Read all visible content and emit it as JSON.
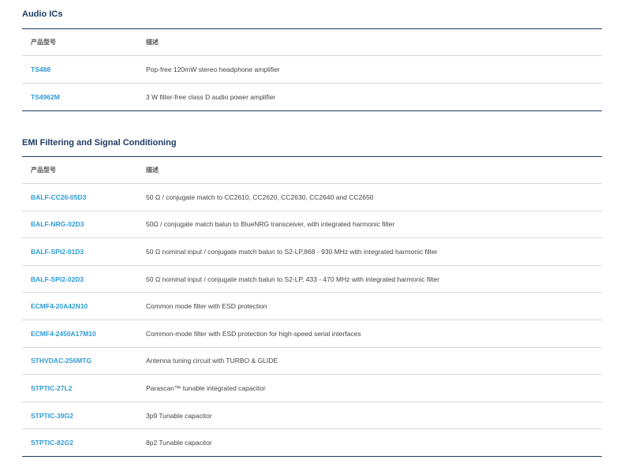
{
  "audio": {
    "title": "Audio ICs",
    "col_part": "产品型号",
    "col_desc": "描述",
    "rows": [
      {
        "part": "TS488",
        "desc": "Pop-free 120mW stereo headphone amplifier"
      },
      {
        "part": "TS4962M",
        "desc": "3 W filter-free class D audio power amplifier"
      }
    ]
  },
  "emi": {
    "title": "EMI Filtering and Signal Conditioning",
    "col_part": "产品型号",
    "col_desc": "描述",
    "rows": [
      {
        "part": "BALF-CC26-05D3",
        "desc": "50 Ω / conjugate match to CC2610, CC2620, CC2630, CC2640 and CC2650"
      },
      {
        "part": "BALF-NRG-02D3",
        "desc": "50Ω / conjugate match balun to BlueNRG transceiver, with integrated harmonic filter"
      },
      {
        "part": "BALF-SPI2-01D3",
        "desc": "50 Ω nominal input / conjugate match balun to S2-LP,868 - 930 MHz with integrated harmonic filter"
      },
      {
        "part": "BALF-SPI2-02D3",
        "desc": "50 Ω nominal input / conjugate match balun to S2-LP, 433 - 470 MHz with integrated harmonic filter"
      },
      {
        "part": "ECMF4-20A42N10",
        "desc": "Common mode filter with ESD protection"
      },
      {
        "part": "ECMF4-2450A17M10",
        "desc": "Common-mode filter with ESD protection for high-speed serial interfaces"
      },
      {
        "part": "STHVDAC-256MTG",
        "desc": "Antenna tuning circuit with TURBO & GLIDE"
      },
      {
        "part": "STPTIC-27L2",
        "desc": "Parascan™ tunable integrated capacitor"
      },
      {
        "part": "STPTIC-39G2",
        "desc": "3p9 Tunable capacitor"
      },
      {
        "part": "STPTIC-82G2",
        "desc": "8p2 Tunable capacitor"
      }
    ]
  },
  "colors": {
    "heading": "#1f3b63",
    "link": "#2e9bd6",
    "rule_dark": "#1f3b63",
    "rule_light": "#d5d9de"
  }
}
